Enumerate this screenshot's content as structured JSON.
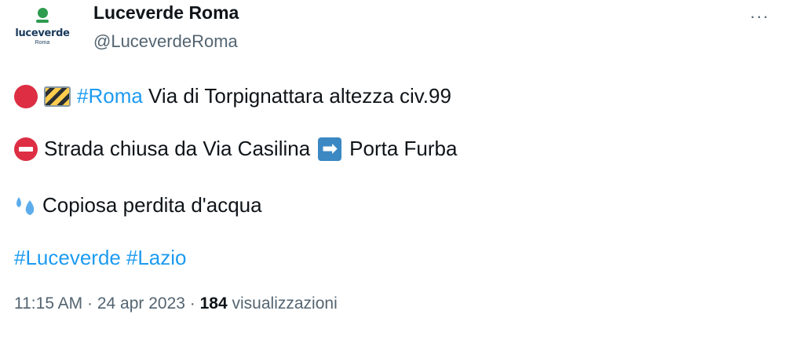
{
  "account": {
    "avatar_brand": "luceverde",
    "avatar_city": "Roma",
    "display_name": "Luceverde Roma",
    "handle": "@LuceverdeRoma",
    "more_icon": "···"
  },
  "tweet": {
    "line1_hashtag": "#Roma",
    "line1_text": " Via di Torpignattara altezza civ.99",
    "line2_text_a": "Strada chiusa da Via Casilina",
    "line2_arrow": "➡",
    "line2_text_b": "Porta Furba",
    "line3_text": "Copiosa perdita d'acqua",
    "hashtag_1": "#Luceverde",
    "hashtag_2": "#Lazio"
  },
  "meta": {
    "time": "11:15 AM",
    "sep1": " · ",
    "date": "24 apr 2023",
    "sep2": " · ",
    "views_count": "184",
    "views_label": " visualizzazioni"
  },
  "colors": {
    "hashtag": "#1d9bf0",
    "secondary_text": "#536471",
    "red_emoji": "#dd2e44",
    "arrow_box": "#3b88c3"
  },
  "icons": [
    "red-circle-icon",
    "construction-barrier-icon",
    "no-entry-icon",
    "right-arrow-icon",
    "sweat-droplets-icon",
    "more-icon"
  ]
}
